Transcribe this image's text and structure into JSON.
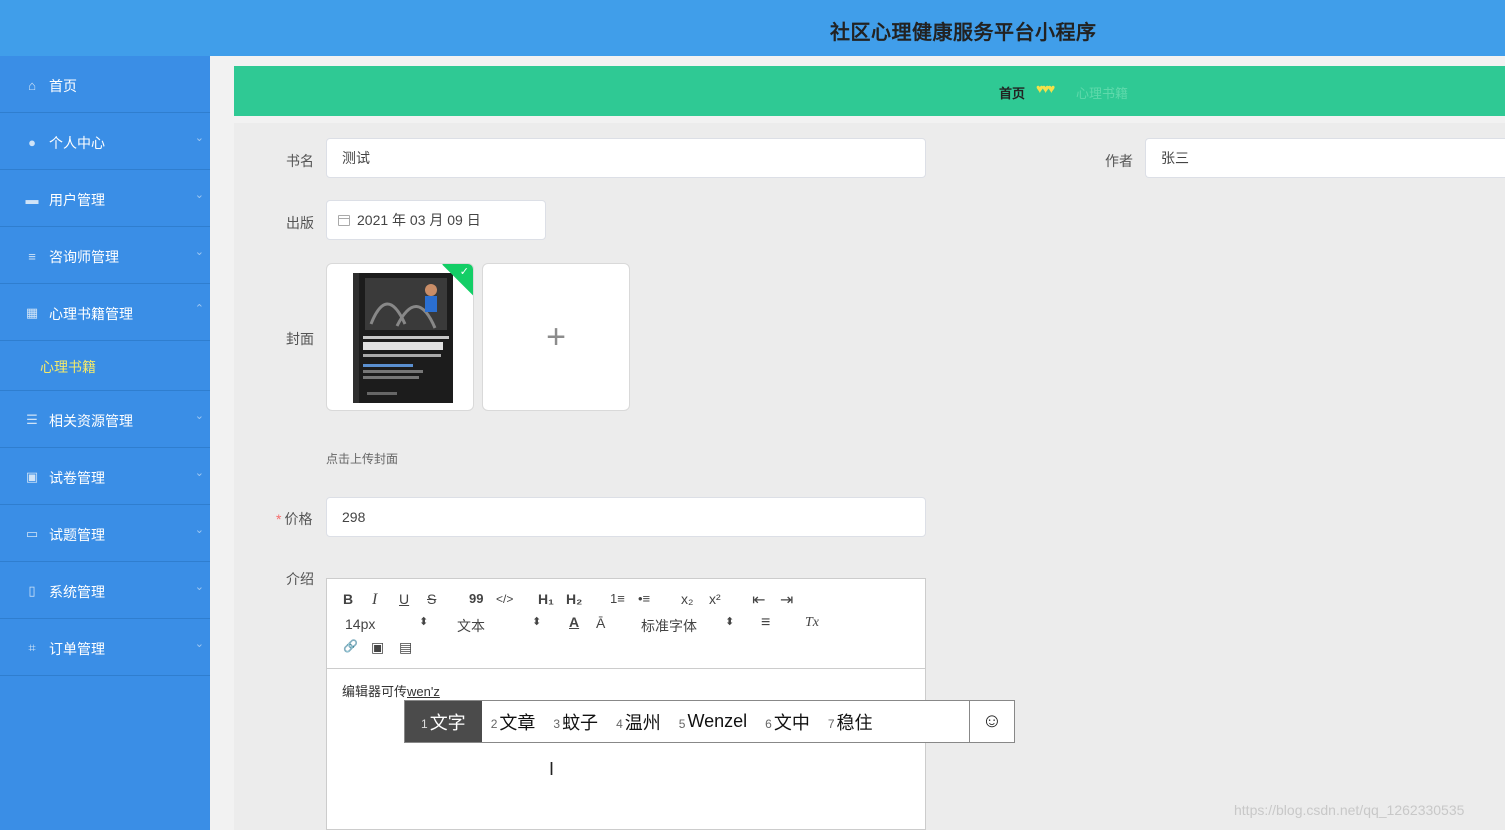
{
  "app": {
    "title": "社区心理健康服务平台小程序"
  },
  "sidebar": {
    "items": [
      {
        "label": "首页",
        "icon": "home-icon",
        "glyph": "⌂",
        "chevron": ""
      },
      {
        "label": "个人中心",
        "icon": "user-icon",
        "glyph": "●",
        "chevron": "⌄"
      },
      {
        "label": "用户管理",
        "icon": "users-icon",
        "glyph": "▬",
        "chevron": "⌄"
      },
      {
        "label": "咨询师管理",
        "icon": "list-icon",
        "glyph": "≡",
        "chevron": "⌄"
      },
      {
        "label": "心理书籍管理",
        "icon": "grid-icon",
        "glyph": "▦",
        "chevron": "⌃"
      },
      {
        "label": "相关资源管理",
        "icon": "list-icon",
        "glyph": "☰",
        "chevron": "⌄"
      },
      {
        "label": "试卷管理",
        "icon": "clipboard-icon",
        "glyph": "▣",
        "chevron": "⌄"
      },
      {
        "label": "试题管理",
        "icon": "chat-icon",
        "glyph": "▭",
        "chevron": "⌄"
      },
      {
        "label": "系统管理",
        "icon": "phone-icon",
        "glyph": "▯",
        "chevron": "⌄"
      },
      {
        "label": "订单管理",
        "icon": "crop-icon",
        "glyph": "⌗",
        "chevron": "⌄"
      }
    ],
    "sub_item": "心理书籍"
  },
  "breadcrumb": {
    "home": "首页",
    "separator": "♥♥♥",
    "current": "心理书籍"
  },
  "form": {
    "book_name_label": "书名",
    "book_name_value": "测试",
    "author_label": "作者",
    "author_value": "张三",
    "publish_label": "出版",
    "publish_value": "2021 年 03 月 09 日",
    "cover_label": "封面",
    "cover_plus": "+",
    "upload_tip": "点击上传封面",
    "price_label": "价格",
    "price_required": "*",
    "price_value": "298",
    "intro_label": "介绍",
    "editor_text": "编辑器可传",
    "editor_composing": "wen'z"
  },
  "toolbar": {
    "bold": "B",
    "italic": "I",
    "underline": "U",
    "strike": "S",
    "quote": "99",
    "code": "</>",
    "h1": "H₁",
    "h2": "H₂",
    "ordered_list": "1≡",
    "bullet_list": "•≡",
    "subscript": "x₂",
    "superscript": "x²",
    "outdent": "⇤",
    "indent": "⇥",
    "size_value": "14px",
    "header_value": "文本",
    "font_value": "标准字体",
    "color": "A",
    "background": "Ā",
    "align": "≡",
    "clean": "Tx",
    "link": "🔗",
    "image": "▣",
    "video": "▤"
  },
  "ime": {
    "candidates": [
      {
        "num": "1",
        "text": "文字"
      },
      {
        "num": "2",
        "text": "文章"
      },
      {
        "num": "3",
        "text": "蚊子"
      },
      {
        "num": "4",
        "text": "温州"
      },
      {
        "num": "5",
        "text": "Wenzel"
      },
      {
        "num": "6",
        "text": "文中"
      },
      {
        "num": "7",
        "text": "稳住"
      }
    ],
    "emoji": "☺"
  },
  "watermark": "https://blog.csdn.net/qq_1262330535"
}
